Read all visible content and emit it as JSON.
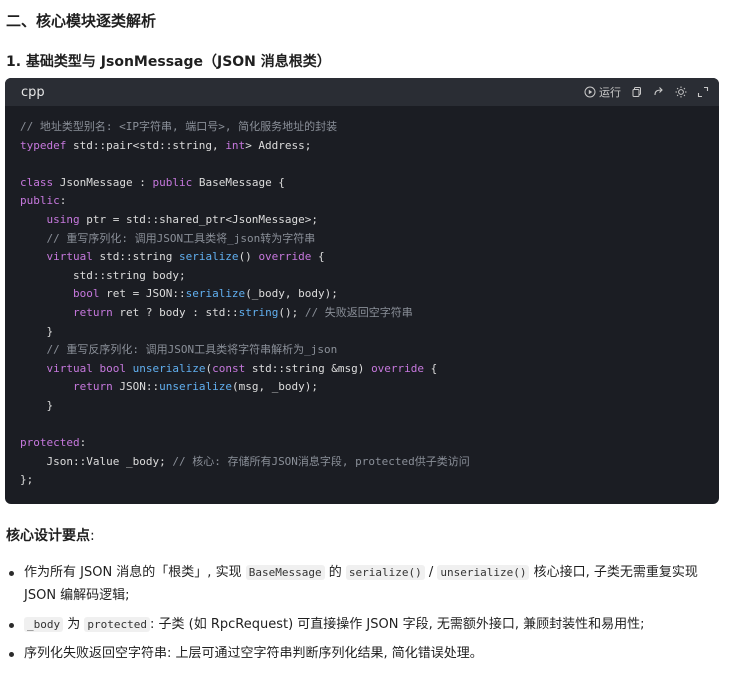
{
  "headings": {
    "section": "二、核心模块逐类解析",
    "sub": "1. 基础类型与 JsonMessage（JSON 消息根类）"
  },
  "code_block": {
    "language": "cpp",
    "run_label": "运行",
    "lines": [
      [
        {
          "c": "cm",
          "t": "// 地址类型别名: <IP字符串, 端口号>, 简化服务地址的封装"
        }
      ],
      [
        {
          "c": "kw",
          "t": "typedef"
        },
        {
          "c": "pl",
          "t": " std::pair<std::string, "
        },
        {
          "c": "kw",
          "t": "int"
        },
        {
          "c": "pl",
          "t": "> Address;"
        }
      ],
      [],
      [
        {
          "c": "kw",
          "t": "class"
        },
        {
          "c": "pl",
          "t": " JsonMessage : "
        },
        {
          "c": "kw",
          "t": "public"
        },
        {
          "c": "pl",
          "t": " BaseMessage {"
        }
      ],
      [
        {
          "c": "kw",
          "t": "public"
        },
        {
          "c": "pl",
          "t": ":"
        }
      ],
      [
        {
          "c": "pl",
          "t": "    "
        },
        {
          "c": "kw",
          "t": "using"
        },
        {
          "c": "pl",
          "t": " ptr = std::shared_ptr<JsonMessage>;"
        }
      ],
      [
        {
          "c": "pl",
          "t": "    "
        },
        {
          "c": "cm",
          "t": "// 重写序列化: 调用JSON工具类将_json转为字符串"
        }
      ],
      [
        {
          "c": "pl",
          "t": "    "
        },
        {
          "c": "kw",
          "t": "virtual"
        },
        {
          "c": "pl",
          "t": " std::string "
        },
        {
          "c": "fn",
          "t": "serialize"
        },
        {
          "c": "pl",
          "t": "() "
        },
        {
          "c": "kw",
          "t": "override"
        },
        {
          "c": "pl",
          "t": " {"
        }
      ],
      [
        {
          "c": "pl",
          "t": "        std::string body;"
        }
      ],
      [
        {
          "c": "pl",
          "t": "        "
        },
        {
          "c": "kw",
          "t": "bool"
        },
        {
          "c": "pl",
          "t": " ret = JSON::"
        },
        {
          "c": "fn",
          "t": "serialize"
        },
        {
          "c": "pl",
          "t": "(_body, body);"
        }
      ],
      [
        {
          "c": "pl",
          "t": "        "
        },
        {
          "c": "kw",
          "t": "return"
        },
        {
          "c": "pl",
          "t": " ret ? body : std::"
        },
        {
          "c": "fn",
          "t": "string"
        },
        {
          "c": "pl",
          "t": "(); "
        },
        {
          "c": "cm",
          "t": "// 失败返回空字符串"
        }
      ],
      [
        {
          "c": "pl",
          "t": "    }"
        }
      ],
      [
        {
          "c": "pl",
          "t": "    "
        },
        {
          "c": "cm",
          "t": "// 重写反序列化: 调用JSON工具类将字符串解析为_json"
        }
      ],
      [
        {
          "c": "pl",
          "t": "    "
        },
        {
          "c": "kw",
          "t": "virtual"
        },
        {
          "c": "pl",
          "t": " "
        },
        {
          "c": "kw",
          "t": "bool"
        },
        {
          "c": "pl",
          "t": " "
        },
        {
          "c": "fn",
          "t": "unserialize"
        },
        {
          "c": "pl",
          "t": "("
        },
        {
          "c": "kw",
          "t": "const"
        },
        {
          "c": "pl",
          "t": " std::string &msg) "
        },
        {
          "c": "kw",
          "t": "override"
        },
        {
          "c": "pl",
          "t": " {"
        }
      ],
      [
        {
          "c": "pl",
          "t": "        "
        },
        {
          "c": "kw",
          "t": "return"
        },
        {
          "c": "pl",
          "t": " JSON::"
        },
        {
          "c": "fn",
          "t": "unserialize"
        },
        {
          "c": "pl",
          "t": "(msg, _body);"
        }
      ],
      [
        {
          "c": "pl",
          "t": "    }"
        }
      ],
      [],
      [
        {
          "c": "kw",
          "t": "protected"
        },
        {
          "c": "pl",
          "t": ":"
        }
      ],
      [
        {
          "c": "pl",
          "t": "    Json::Value _body; "
        },
        {
          "c": "cm",
          "t": "// 核心: 存储所有JSON消息字段, protected供子类访问"
        }
      ],
      [
        {
          "c": "pl",
          "t": "};"
        }
      ]
    ]
  },
  "design": {
    "title": "核心设计要点",
    "colon": ":",
    "bullets": [
      [
        {
          "t": "作为所有 JSON 消息的「根类」, 实现 "
        },
        {
          "code": "BaseMessage"
        },
        {
          "t": " 的 "
        },
        {
          "code": "serialize()"
        },
        {
          "t": " / "
        },
        {
          "code": "unserialize()"
        },
        {
          "t": " 核心接口, 子类无需重复实现 JSON 编解码逻辑;"
        }
      ],
      [
        {
          "code": "_body"
        },
        {
          "t": " 为 "
        },
        {
          "code": "protected"
        },
        {
          "t": ": 子类 (如 RpcRequest) 可直接操作 JSON 字段, 无需额外接口, 兼顾封装性和易用性;"
        }
      ],
      [
        {
          "t": "序列化失败返回空字符串: 上层可通过空字符串判断序列化结果, 简化错误处理。"
        }
      ]
    ]
  }
}
